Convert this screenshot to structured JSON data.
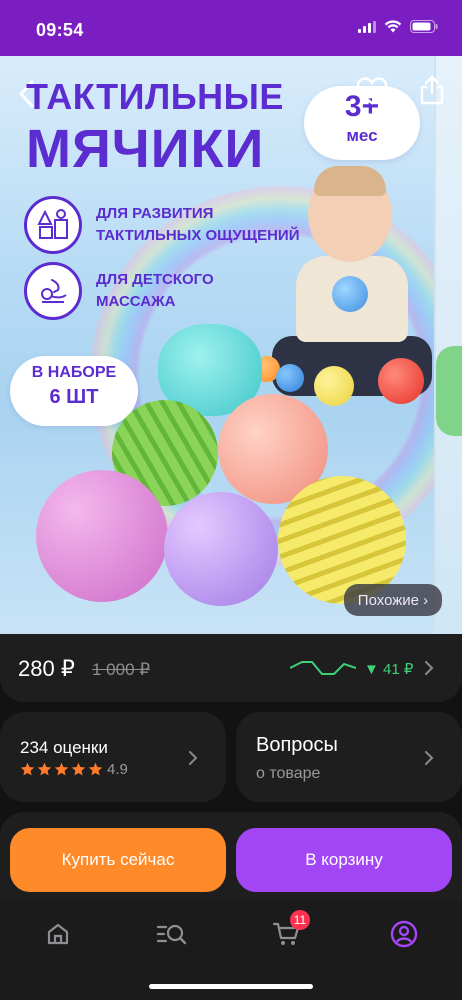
{
  "status_bar": {
    "time": "09:54"
  },
  "product_image": {
    "title_line1": "ТАКТИЛЬНЫЕ",
    "title_line2": "МЯЧИКИ",
    "age": {
      "value": "3+",
      "unit": "мес"
    },
    "features": [
      {
        "line1": "ДЛЯ РАЗВИТИЯ",
        "line2": "ТАКТИЛЬНЫХ ОЩУЩЕНИЙ",
        "icon": "toy-blocks-icon"
      },
      {
        "line1": "ДЛЯ ДЕТСКОГО",
        "line2": "МАССАЖА",
        "icon": "baby-massage-icon"
      }
    ],
    "set_badge": {
      "line1": "В НАБОРЕ",
      "line2": "6 ШТ"
    },
    "similar_label": "Похожие ›"
  },
  "price": {
    "current": "280 ₽",
    "old": "1 000 ₽",
    "drop": "▼ 41 ₽",
    "trend_color": "#3dd17a"
  },
  "rating": {
    "count_label": "234 оценки",
    "value": "4.9",
    "stars": 5,
    "star_color": "#ff7a2a"
  },
  "questions": {
    "title": "Вопросы",
    "subtitle": "о товаре"
  },
  "actions": {
    "buy_now": "Купить сейчас",
    "add_to_cart": "В корзину",
    "buy_color": "#ff8a2a",
    "cart_color": "#a347f6"
  },
  "tabbar": {
    "items": [
      {
        "icon": "home-icon"
      },
      {
        "icon": "catalog-search-icon"
      },
      {
        "icon": "cart-icon"
      },
      {
        "icon": "profile-icon"
      }
    ],
    "cart_badge": "11"
  },
  "colors": {
    "status_bar": "#7a1ec2",
    "brand_text": "#5b2ccf",
    "background": "#121212"
  }
}
